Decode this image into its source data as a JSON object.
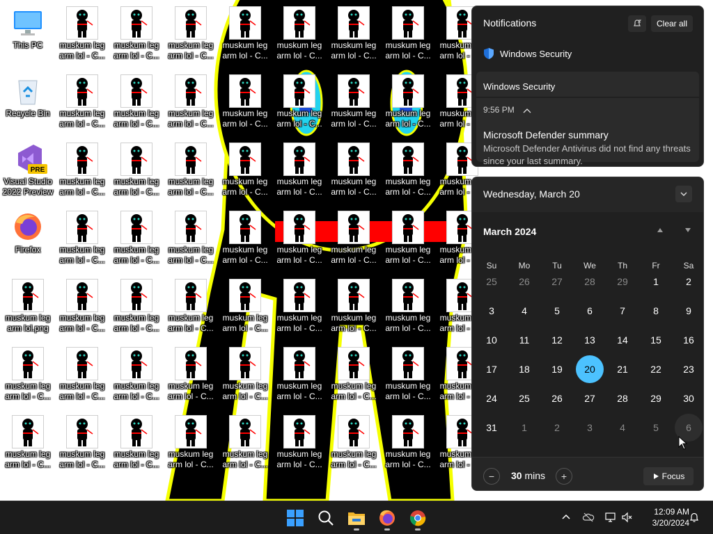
{
  "desktop": {
    "icon_labels": {
      "this_pc": "This PC",
      "recycle_bin": "Recycle Bin",
      "visual_studio": "Visual Studio 2022 Preview",
      "visual_studio_badge": "PRE",
      "firefox": "Firefox",
      "png_file": "muskum leg arm lol.png",
      "file_copy": "muskum leg arm lol - C..."
    }
  },
  "notifications": {
    "title": "Notifications",
    "clear_all": "Clear all",
    "app_name": "Windows Security",
    "card": {
      "source": "Windows Security",
      "time": "9:56 PM",
      "title": "Microsoft Defender summary",
      "body": "Microsoft Defender Antivirus did not find any threats since your last summary."
    }
  },
  "calendar": {
    "date_header": "Wednesday, March 20",
    "month_label": "March 2024",
    "weekdays": [
      "Su",
      "Mo",
      "Tu",
      "We",
      "Th",
      "Fr",
      "Sa"
    ],
    "weeks": [
      [
        "25",
        "26",
        "27",
        "28",
        "29",
        "1",
        "2"
      ],
      [
        "3",
        "4",
        "5",
        "6",
        "7",
        "8",
        "9"
      ],
      [
        "10",
        "11",
        "12",
        "13",
        "14",
        "15",
        "16"
      ],
      [
        "17",
        "18",
        "19",
        "20",
        "21",
        "22",
        "23"
      ],
      [
        "24",
        "25",
        "26",
        "27",
        "28",
        "29",
        "30"
      ],
      [
        "31",
        "1",
        "2",
        "3",
        "4",
        "5",
        "6"
      ]
    ],
    "selected_day": "20",
    "focus": {
      "minutes": "30",
      "unit": "mins",
      "minus": "−",
      "plus": "+",
      "button": "Focus"
    }
  },
  "taskbar": {
    "apps": [
      "start",
      "search",
      "file-explorer",
      "firefox",
      "chrome"
    ],
    "time": "12:09 AM",
    "date": "3/20/2024"
  },
  "colors": {
    "accent": "#4cc2ff",
    "panel": "#202020",
    "taskbar": "#1c1c1c",
    "figure_outline": "#f5ff00",
    "sash": "#ff0000"
  }
}
